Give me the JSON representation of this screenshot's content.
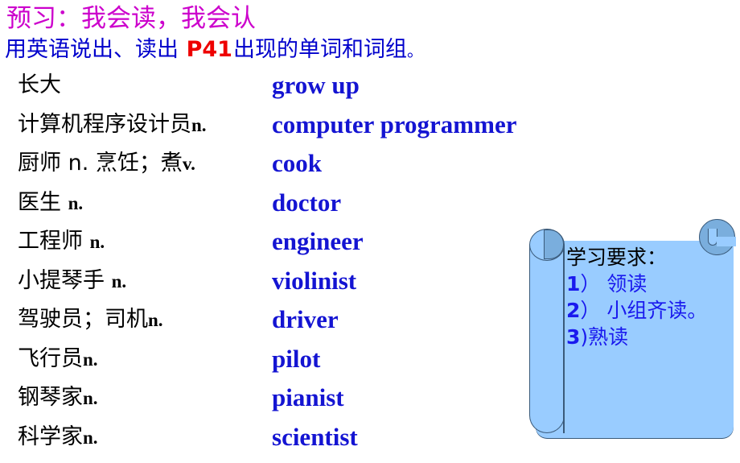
{
  "slide": {
    "title": "预习：我会读，我会认",
    "title_color": "#cc00cc",
    "subtitle_before": "用英语说出、读出 ",
    "subtitle_highlight": "P41",
    "subtitle_after": "出现的单词和词组",
    "subtitle_tail": "。",
    "subtitle_color": "#0000cc",
    "highlight_color": "#ee0000",
    "background_color": "#ffffff"
  },
  "vocab": {
    "chinese_color": "#000000",
    "english_color": "#1414d2",
    "rows": [
      {
        "cn": "长大",
        "pos": "",
        "en": "grow up"
      },
      {
        "cn": "计算机程序设计员",
        "pos": "n.",
        "en": "computer programmer"
      },
      {
        "cn": "厨师 n. 烹饪；煮",
        "pos": "v.",
        "en": "cook"
      },
      {
        "cn": "医生 ",
        "pos": "n.",
        "en": "doctor"
      },
      {
        "cn": "工程师 ",
        "pos": "n.",
        "en": "engineer"
      },
      {
        "cn": "小提琴手 ",
        "pos": "n.",
        "en": "violinist"
      },
      {
        "cn": "驾驶员；司机",
        "pos": "n.",
        "en": "driver"
      },
      {
        "cn": "飞行员",
        "pos": "n.",
        "en": "pilot"
      },
      {
        "cn": "钢琴家",
        "pos": "n.",
        "en": "pianist"
      },
      {
        "cn": "科学家",
        "pos": "n.",
        "en": "scientist"
      }
    ]
  },
  "scroll_note": {
    "heading": "学习要求：",
    "heading_color": "#000000",
    "item_color": "#1a1aee",
    "paper_color": "#99ccff",
    "roll_color": "#7aaedd",
    "outline_color": "#3a5a7a",
    "items": [
      {
        "num": "1",
        "paren": "）",
        "text": " 领读"
      },
      {
        "num": "2",
        "paren": "）",
        "text": " 小组齐读。"
      },
      {
        "num": "3",
        "paren": ")",
        "text": "熟读"
      }
    ]
  }
}
